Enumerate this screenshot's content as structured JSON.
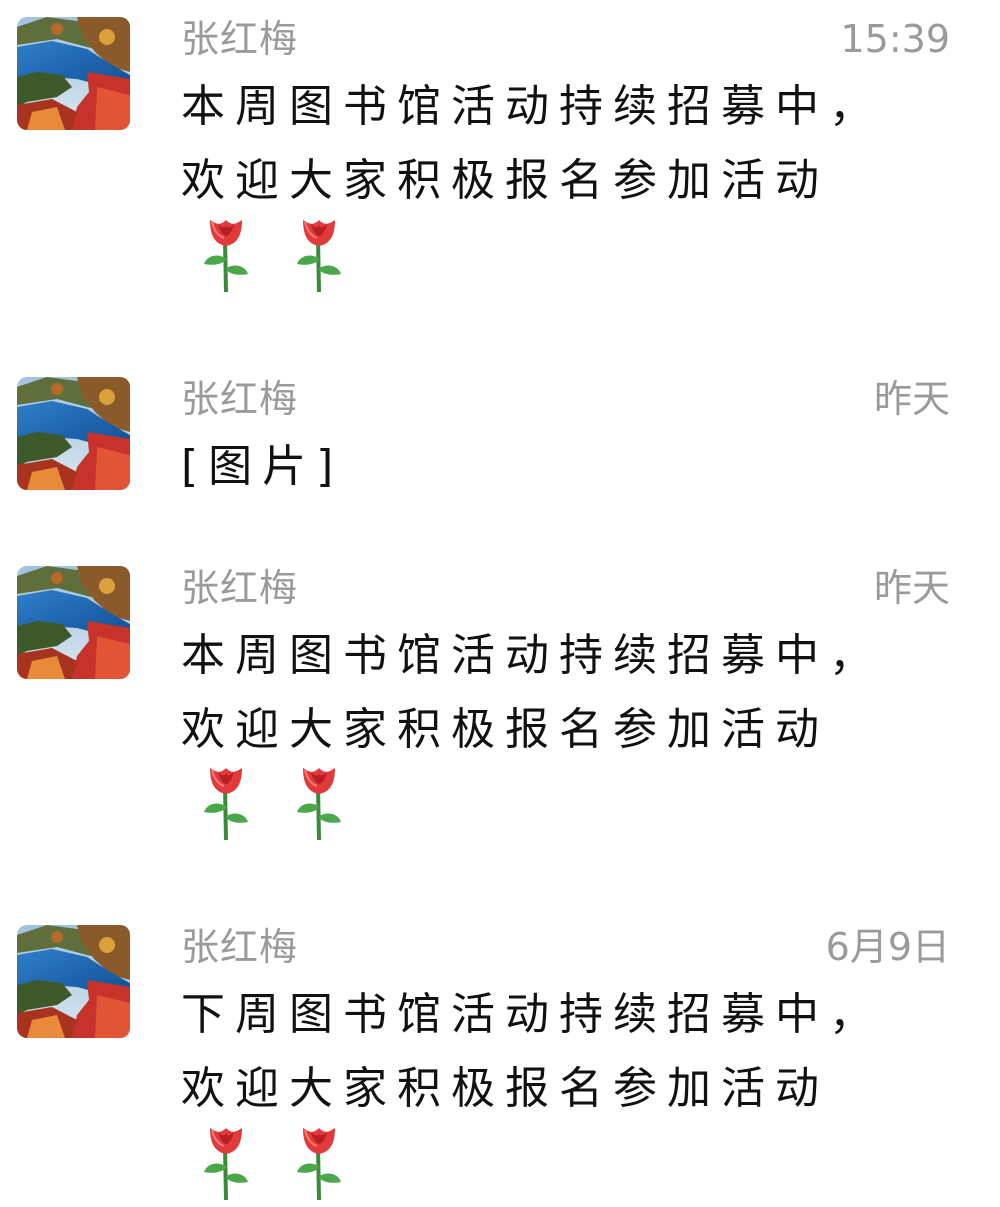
{
  "messages": [
    {
      "sender": "张红梅",
      "time": "15:39",
      "lines": [
        "本周图书馆活动持续招募中，",
        "欢迎大家积极报名参加活动"
      ],
      "emoji": [
        "rose-icon",
        "rose-icon"
      ]
    },
    {
      "sender": "张红梅",
      "time": "昨天",
      "lines": [
        "[图片]"
      ],
      "emoji": []
    },
    {
      "sender": "张红梅",
      "time": "昨天",
      "lines": [
        "本周图书馆活动持续招募中，",
        "欢迎大家积极报名参加活动"
      ],
      "emoji": [
        "rose-icon",
        "rose-icon"
      ]
    },
    {
      "sender": "张红梅",
      "time": "6月9日",
      "lines": [
        "下周图书馆活动持续招募中，",
        "欢迎大家积极报名参加活动"
      ],
      "emoji": [
        "rose-icon",
        "rose-icon"
      ]
    }
  ],
  "colors": {
    "sender_text": "#9a9a9a",
    "time_text": "#9a9a9a",
    "body_text": "#111111",
    "background": "#ffffff"
  }
}
